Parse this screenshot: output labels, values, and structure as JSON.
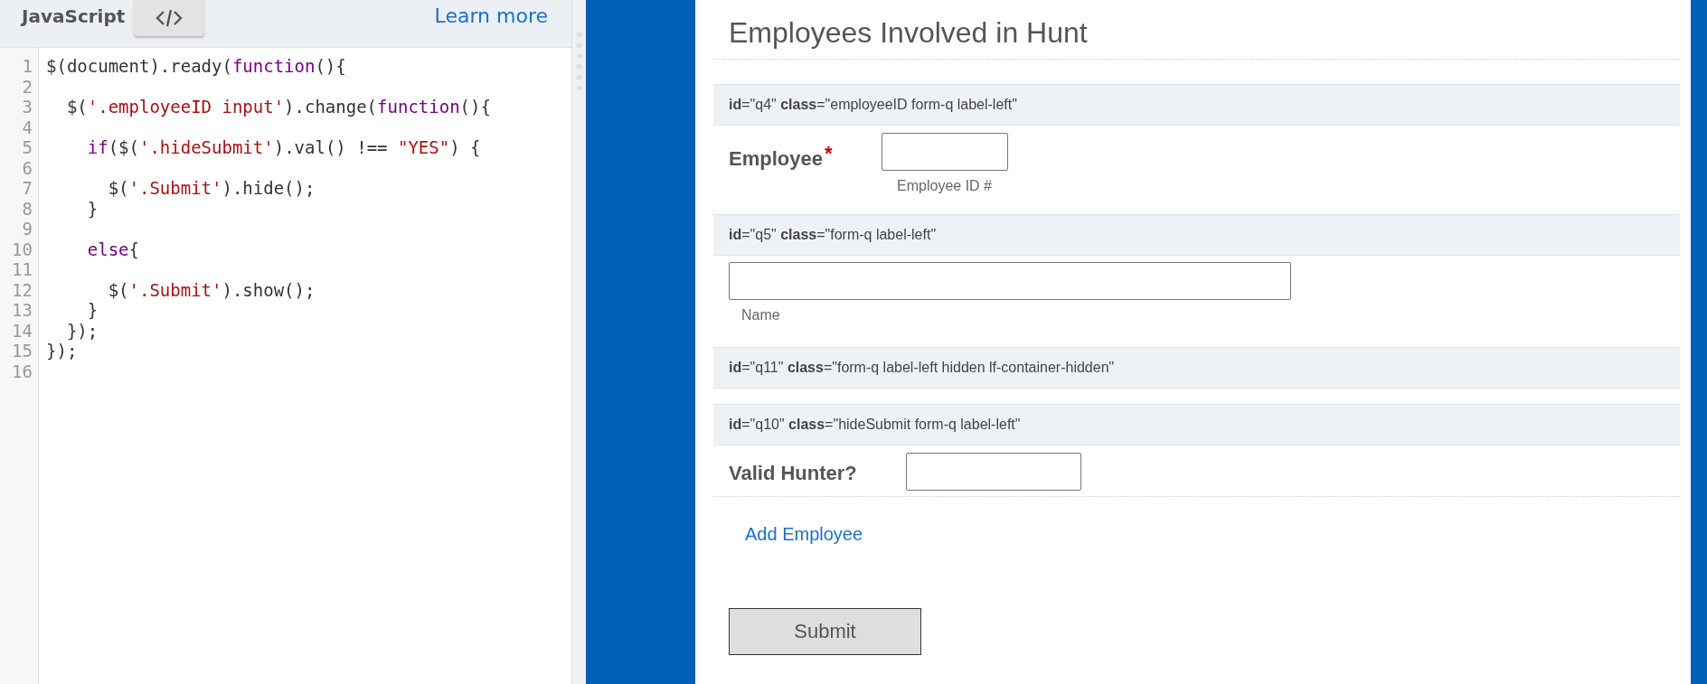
{
  "editor": {
    "language": "JavaScript",
    "learn_more": "Learn more",
    "lines": [
      {
        "number": "1",
        "tokens": [
          {
            "kind": "plain",
            "text": "$(document).ready("
          },
          {
            "kind": "keyword",
            "text": "function"
          },
          {
            "kind": "plain",
            "text": "(){"
          }
        ]
      },
      {
        "number": "2"
      },
      {
        "number": "3",
        "tokens": [
          {
            "kind": "plain",
            "text": "  $("
          },
          {
            "kind": "string",
            "text": "'.employeeID input'"
          },
          {
            "kind": "plain",
            "text": ").change("
          },
          {
            "kind": "keyword",
            "text": "function"
          },
          {
            "kind": "plain",
            "text": "(){"
          }
        ]
      },
      {
        "number": "4"
      },
      {
        "number": "5",
        "tokens": [
          {
            "kind": "keyword",
            "text": "    if"
          },
          {
            "kind": "plain",
            "text": "($("
          },
          {
            "kind": "string",
            "text": "'.hideSubmit'"
          },
          {
            "kind": "plain",
            "text": ").val() !== "
          },
          {
            "kind": "string",
            "text": "\"YES\""
          },
          {
            "kind": "plain",
            "text": ") {"
          }
        ]
      },
      {
        "number": "6"
      },
      {
        "number": "7",
        "tokens": [
          {
            "kind": "plain",
            "text": "      $("
          },
          {
            "kind": "string",
            "text": "'.Submit'"
          },
          {
            "kind": "plain",
            "text": ").hide();"
          }
        ]
      },
      {
        "number": "8",
        "tokens": [
          {
            "kind": "plain",
            "text": "    }"
          }
        ]
      },
      {
        "number": "9"
      },
      {
        "number": "10",
        "tokens": [
          {
            "kind": "keyword",
            "text": "    else"
          },
          {
            "kind": "plain",
            "text": "{"
          }
        ]
      },
      {
        "number": "11"
      },
      {
        "number": "12",
        "tokens": [
          {
            "kind": "plain",
            "text": "      $("
          },
          {
            "kind": "string",
            "text": "'.Submit'"
          },
          {
            "kind": "plain",
            "text": ").show();"
          }
        ]
      },
      {
        "number": "13",
        "tokens": [
          {
            "kind": "plain",
            "text": "    }"
          }
        ]
      },
      {
        "number": "14",
        "tokens": [
          {
            "kind": "plain",
            "text": "  });"
          }
        ]
      },
      {
        "number": "15",
        "tokens": [
          {
            "kind": "plain",
            "text": "});"
          }
        ]
      },
      {
        "number": "16"
      }
    ]
  },
  "form": {
    "title": "Employees Involved in Hunt",
    "sections": [
      {
        "kind": "debug",
        "text": "**id**=\"q4\" **class**=\"employeeID form-q label-left\""
      },
      {
        "kind": "inline",
        "label": "Employee",
        "required_mark": "*",
        "hint": "Employee ID #"
      },
      {
        "kind": "debug",
        "text": "**id**=\"q5\" **class**=\"form-q label-left\""
      },
      {
        "kind": "stacked",
        "hint": "Name"
      },
      {
        "kind": "debug",
        "text": "**id**=\"q11\" **class**=\"form-q label-left hidden lf-container-hidden\""
      },
      {
        "kind": "debug",
        "text": "**id**=\"q10\" **class**=\"hideSubmit form-q label-left\""
      },
      {
        "kind": "inline",
        "label": "Valid Hunter?"
      }
    ],
    "add_link": "Add Employee",
    "submit": "Submit"
  }
}
